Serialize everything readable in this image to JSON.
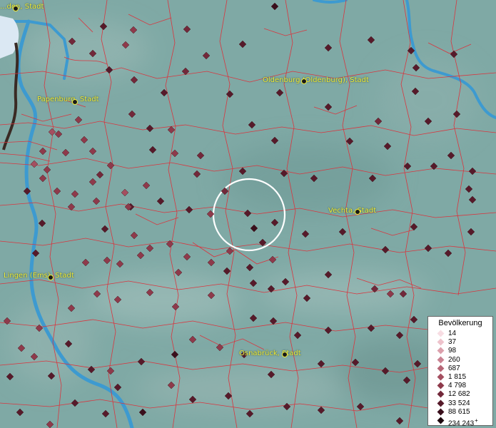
{
  "map": {
    "colors": {
      "land": "#7fa9a5",
      "water": "#3d9ad0",
      "boundary": "#d8363f",
      "label": "#f2ee3a",
      "selection_ring": "#ffffff"
    },
    "cities": [
      {
        "label": "Papenburg, Stadt"
      },
      {
        "label": "Oldenburg (Oldenburg), Stadt"
      },
      {
        "label": "Vechta, Stadt"
      },
      {
        "label": "Lingen (Ems), Stadt"
      },
      {
        "label": "Osnabrück, Stadt"
      },
      {
        "label": "...den, Stadt"
      }
    ]
  },
  "legend": {
    "title": "Bevölkerung",
    "items": [
      {
        "label": "14",
        "color": "#f7dde3"
      },
      {
        "label": "37",
        "color": "#eec3cc"
      },
      {
        "label": "98",
        "color": "#dca0ac"
      },
      {
        "label": "260",
        "color": "#c98292"
      },
      {
        "label": "687",
        "color": "#b66777"
      },
      {
        "label": "1 815",
        "color": "#a44f60"
      },
      {
        "label": "4 798",
        "color": "#8e3a4b"
      },
      {
        "label": "12 682",
        "color": "#72283a"
      },
      {
        "label": "33 524",
        "color": "#561a2a"
      },
      {
        "label": "88 615",
        "color": "#3a0f1c"
      },
      {
        "label": "234 243",
        "color": "#1e070e"
      }
    ],
    "overflow_marker": "+"
  }
}
